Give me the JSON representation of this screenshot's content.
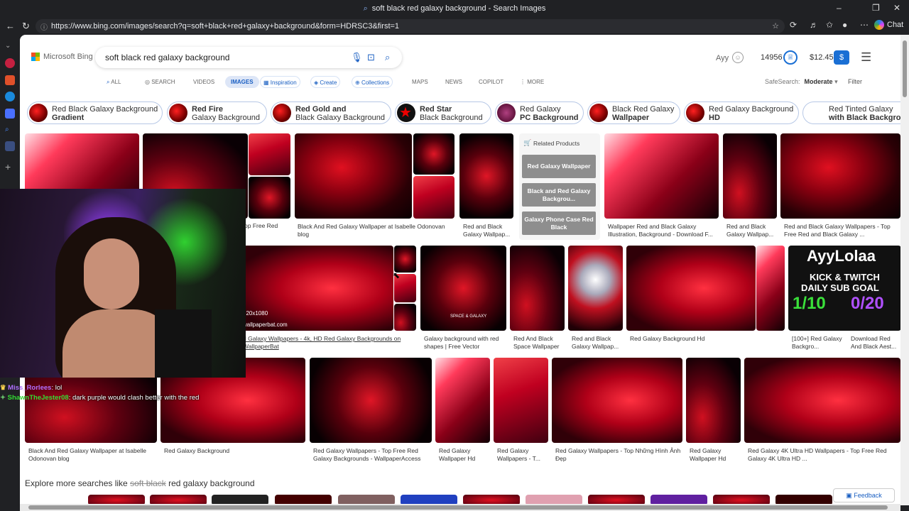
{
  "window": {
    "title": "soft black red galaxy background - Search Images"
  },
  "browser": {
    "url": "https://www.bing.com/images/search?q=soft+black+red+galaxy+background&form=HDRSC3&first=1",
    "chat_label": "Chat"
  },
  "bing": {
    "logo_text": "Microsoft Bing",
    "query": "soft black red galaxy background",
    "user_name": "Ayy",
    "points": "14956",
    "money": "$12.45",
    "money_icon": "$",
    "tabs": [
      {
        "label": "ALL",
        "icon": "⌕"
      },
      {
        "label": "SEARCH",
        "icon": "◎"
      },
      {
        "label": "VIDEOS"
      },
      {
        "label": "IMAGES"
      },
      {
        "label": "Inspiration",
        "icon": "▦"
      },
      {
        "label": "Create",
        "icon": "◈"
      },
      {
        "label": "Collections",
        "icon": "⊕"
      },
      {
        "label": "MAPS"
      },
      {
        "label": "NEWS"
      },
      {
        "label": "COPILOT"
      },
      {
        "label": "MORE",
        "icon": "⋮"
      }
    ],
    "safesearch_label": "SafeSearch:",
    "safesearch_value": "Moderate",
    "filter_label": "Filter"
  },
  "chips": [
    {
      "line1": "Red Black Galaxy Background",
      "line2": "Gradient"
    },
    {
      "line1": "Red Fire",
      "line2": "Galaxy Background"
    },
    {
      "line1": "Red Gold and",
      "line2": "Black Galaxy Background"
    },
    {
      "line1": "Red Star",
      "line2": "Black Background"
    },
    {
      "line1": "Red Galaxy",
      "line2": "PC Background"
    },
    {
      "line1": "Black Red Galaxy",
      "line2": "Wallpaper"
    },
    {
      "line1": "Red Galaxy Background",
      "line2": "HD"
    },
    {
      "line1": "Red Tinted Galaxy",
      "line2": "with Black Background"
    }
  ],
  "related": {
    "title": "Related Products",
    "items": [
      "Red Galaxy Wallpaper",
      "Black and Red Galaxy Backgrou...",
      "Galaxy Phone Case Red Black"
    ]
  },
  "results": {
    "row1": [
      "op Free Red",
      "Black And Red Galaxy Wallpaper at Isabelle Odonovan blog",
      "Red and Black Galaxy Wallpap...",
      "Wallpaper Red and Black Galaxy Illustration, Background - Download F...",
      "Red and Black Galaxy Wallpap...",
      "Red and Black Galaxy Wallpapers - Top Free Red and Black Galaxy ..."
    ],
    "row2": [
      "d Galaxy Wallpapers - 4k, HD Red Galaxy Backgrounds on WallpaperBat",
      "Galaxy background with red shapes | Free Vector",
      "Red And Black Space Wallpaper",
      "Red and Black Galaxy Wallpap...",
      "Red Galaxy Background Hd",
      "[100+] Red Galaxy Backgro...",
      "Download Red And Black Aest..."
    ],
    "row3": [
      "Black And Red Galaxy Wallpaper at Isabelle Odonovan blog",
      "Red Galaxy Background",
      "Red Galaxy Wallpapers - Top Free Red Galaxy Backgrounds - WallpaperAccess",
      "Red Galaxy Wallpaper Hd",
      "Red Galaxy Wallpapers - T...",
      "Red Galaxy Wallpapers - Top Những Hình Ảnh Đẹp",
      "Red Galaxy Wallpaper Hd",
      "Red Galaxy 4K Ultra HD Wallpapers - Top Free Red Galaxy 4K Ultra HD ..."
    ],
    "overlay_texts": {
      "wallpaperbat_size": "920x1080",
      "wallpaperbat_domain": "wallpaperbat.com",
      "space_galaxy": "SPACE & GALAXY",
      "twitch_name": "AyyLolaa",
      "twitch_line1": "KICK & TWITCH",
      "twitch_line2": "DAILY SUB GOAL",
      "twitch_left": "1/10",
      "twitch_right": "0/20"
    }
  },
  "explore": {
    "prefix": "Explore more searches like ",
    "strike": "soft black",
    "rest": " red galaxy background"
  },
  "feedback": "Feedback",
  "stream_chat": [
    {
      "user": "Miss_Rorlees",
      "message": ": lol",
      "color": "#b070ff"
    },
    {
      "user": "ShawnTheJester08",
      "message": ": dark purple would clash better with the red",
      "color": "#33dd33"
    }
  ]
}
